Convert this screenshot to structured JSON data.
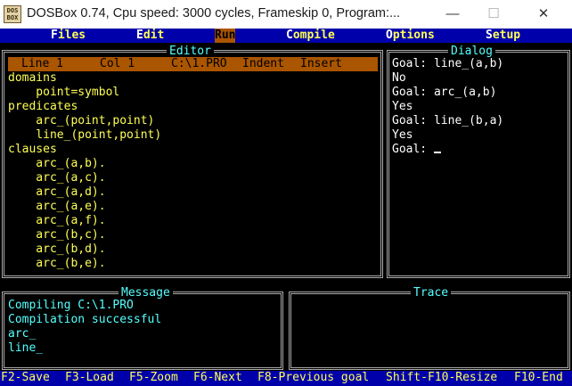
{
  "window": {
    "title": "DOSBox 0.74, Cpu speed:      3000 cycles, Frameskip  0, Program:...",
    "icon_text_1": "DOS",
    "icon_text_2": "BOX",
    "minimize": "—",
    "maximize": "☐",
    "close": "✕"
  },
  "menu": [
    {
      "hot": "F",
      "rest": "iles"
    },
    {
      "hot": "E",
      "rest": "dit"
    },
    {
      "hot": "R",
      "rest": "un"
    },
    {
      "hot": "C",
      "rest": "ompile"
    },
    {
      "hot": "O",
      "rest": "ptions"
    },
    {
      "hot": "S",
      "rest": "etup"
    }
  ],
  "editor": {
    "title": "Editor",
    "status": {
      "line": "Line 1",
      "col": "Col 1",
      "file": "C:\\1.PRO",
      "indent": "Indent",
      "insert": "Insert"
    },
    "lines": [
      "domains",
      "    point=symbol",
      "predicates",
      "    arc_(point,point)",
      "    line_(point,point)",
      "clauses",
      "    arc_(a,b).",
      "    arc_(a,c).",
      "    arc_(a,d).",
      "    arc_(a,e).",
      "    arc_(a,f).",
      "    arc_(b,c).",
      "    arc_(b,d).",
      "    arc_(b,e)."
    ]
  },
  "dialog": {
    "title": "Dialog",
    "lines": [
      "Goal: line_(a,b)",
      "No",
      "Goal: arc_(a,b)",
      "Yes",
      "Goal: line_(b,a)",
      "Yes",
      "Goal: "
    ]
  },
  "message": {
    "title": "Message",
    "lines": [
      "Compiling C:\\1.PRO",
      "Compilation successful",
      "arc_",
      "line_"
    ]
  },
  "trace": {
    "title": "Trace"
  },
  "keys": [
    "F2-Save",
    "F3-Load",
    "F5-Zoom",
    "F6-Next",
    "F8-Previous goal",
    "Shift-F10-Resize",
    "F10-End"
  ]
}
